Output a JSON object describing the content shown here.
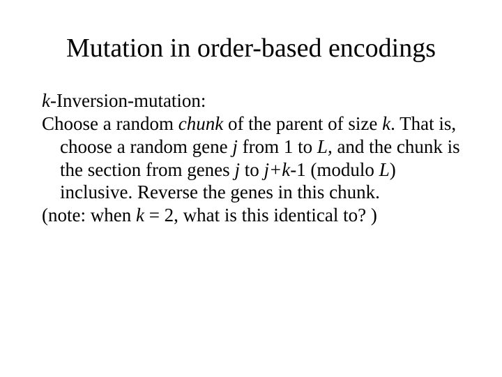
{
  "title": "Mutation in order-based encodings",
  "line1_prefix_italic": "k",
  "line1_rest": "-Inversion-mutation:",
  "def_a": "Choose a random ",
  "def_chunk": "chunk",
  "def_b": " of the parent of size ",
  "def_k1": "k",
  "def_c": ". That is, choose a random gene ",
  "def_j1": "j",
  "def_d": " from 1 to ",
  "def_L1": "L,",
  "def_e": " and the chunk is the section from genes  ",
  "def_j2": "j",
  "def_f": " to ",
  "def_jk": "j+k",
  "def_g": "-1 (modulo ",
  "def_L2": "L",
  "def_h": ") inclusive. Reverse the genes in this chunk.",
  "note_a": "(note: when ",
  "note_k": "k",
  "note_b": " = 2, what is this identical to? )"
}
